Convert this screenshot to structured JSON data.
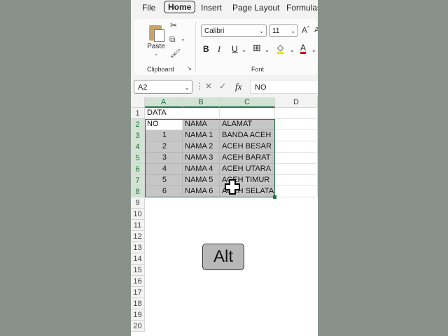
{
  "tabs": [
    "File",
    "Home",
    "Insert",
    "Page Layout",
    "Formulas"
  ],
  "active_tab": "Home",
  "ribbon": {
    "paste_label": "Paste",
    "clipboard_label": "Clipboard",
    "font_label": "Font",
    "font_name": "Calibri",
    "font_size": "11",
    "bold": "B",
    "italic": "I",
    "underline": "U",
    "grow_font": "A^",
    "font_color_glyph": "A"
  },
  "formula_bar": {
    "name_box": "A2",
    "fx": "fx",
    "value": "NO"
  },
  "columns": [
    "A",
    "B",
    "C",
    "D"
  ],
  "rows": [
    "1",
    "2",
    "3",
    "4",
    "5",
    "6",
    "7",
    "8",
    "9",
    "10",
    "11",
    "12",
    "13",
    "14",
    "15",
    "16",
    "17",
    "18",
    "19",
    "20"
  ],
  "cells": {
    "a1": "DATA",
    "headers": [
      "NO",
      "NAMA",
      "ALAMAT"
    ],
    "data": [
      [
        "1",
        "NAMA 1",
        "BANDA ACEH"
      ],
      [
        "2",
        "NAMA 2",
        "ACEH BESAR"
      ],
      [
        "3",
        "NAMA 3",
        "ACEH BARAT"
      ],
      [
        "4",
        "NAMA 4",
        "ACEH UTARA"
      ],
      [
        "5",
        "NAMA 5",
        "ACEH TIMUR"
      ],
      [
        "6",
        "NAMA 6",
        "ACEH SELATAN"
      ]
    ]
  },
  "overlay_key": "Alt",
  "colors": {
    "accent": "#217346",
    "selection_fill": "#c6c6c6",
    "background": "#8a918a"
  }
}
